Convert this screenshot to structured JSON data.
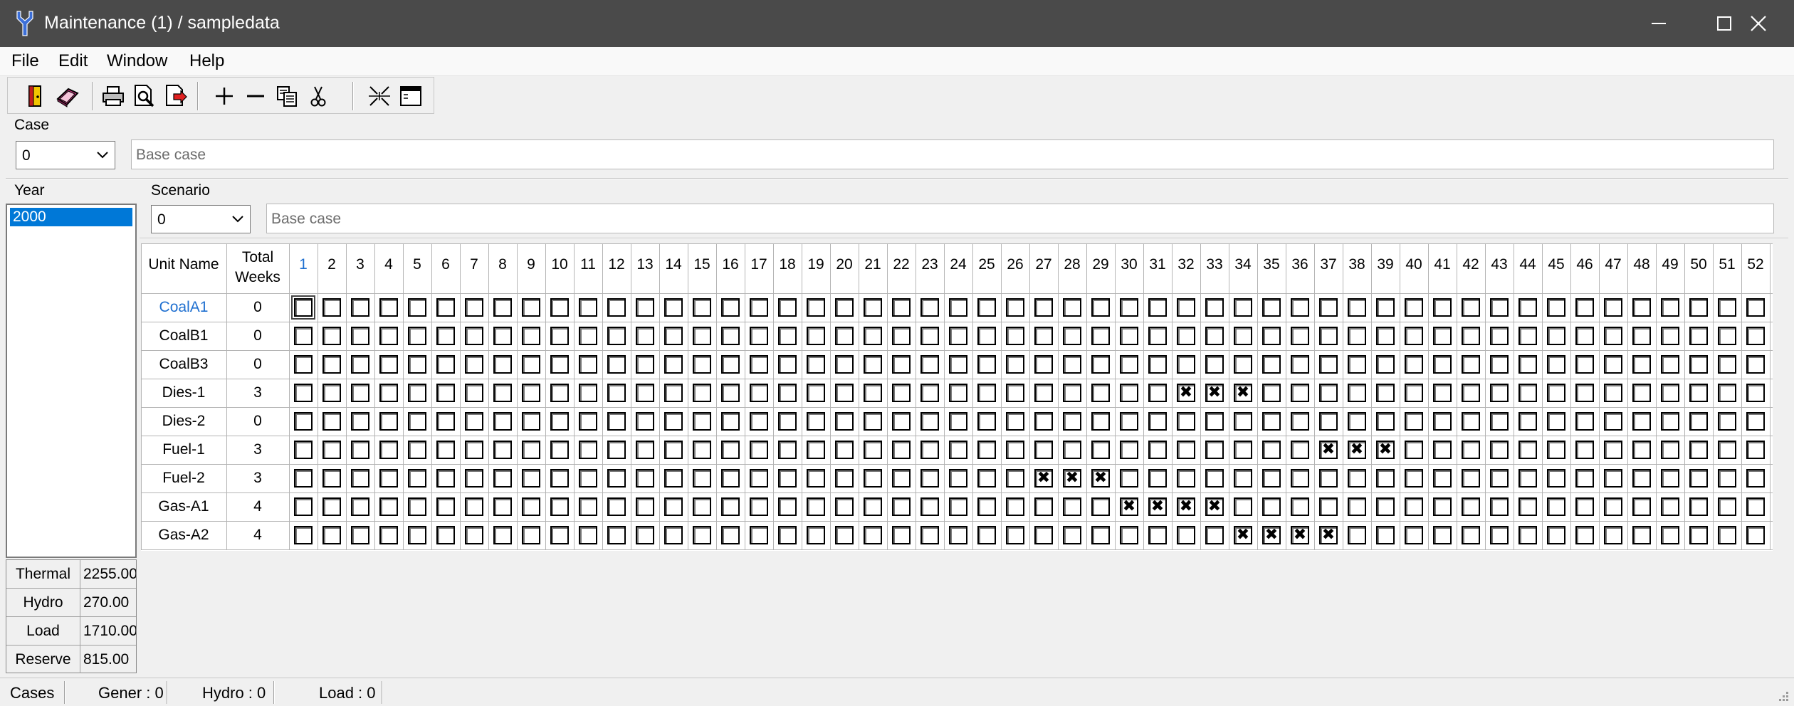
{
  "window": {
    "title": "Maintenance (1)  /  sampledata"
  },
  "menu": [
    "File",
    "Edit",
    "Window",
    "Help"
  ],
  "toolbar_icons": [
    "exit-icon",
    "book-icon",
    "print-icon",
    "print-preview-icon",
    "export-icon",
    "add-icon",
    "remove-icon",
    "copy-icon",
    "cut-icon",
    "expand-icon",
    "window-icon"
  ],
  "case": {
    "label": "Case",
    "value": "0",
    "description": "Base case"
  },
  "year": {
    "label": "Year",
    "items": [
      "2000"
    ],
    "selected": "2000"
  },
  "scenario": {
    "label": "Scenario",
    "value": "0",
    "description": "Base case"
  },
  "summary": [
    {
      "label": "Thermal",
      "value": "2255.00"
    },
    {
      "label": "Hydro",
      "value": "270.00"
    },
    {
      "label": "Load",
      "value": "1710.00"
    },
    {
      "label": "Reserve",
      "value": "815.00"
    }
  ],
  "grid": {
    "header_unit": "Unit Name",
    "header_total_1": "Total",
    "header_total_2": "Weeks",
    "weeks": 52,
    "active_week": 1,
    "rows": [
      {
        "name": "CoalA1",
        "total": "0",
        "checked": []
      },
      {
        "name": "CoalB1",
        "total": "0",
        "checked": []
      },
      {
        "name": "CoalB3",
        "total": "0",
        "checked": []
      },
      {
        "name": "Dies-1",
        "total": "3",
        "checked": [
          32,
          33,
          34
        ]
      },
      {
        "name": "Dies-2",
        "total": "0",
        "checked": []
      },
      {
        "name": "Fuel-1",
        "total": "3",
        "checked": [
          37,
          38,
          39
        ]
      },
      {
        "name": "Fuel-2",
        "total": "3",
        "checked": [
          27,
          28,
          29
        ]
      },
      {
        "name": "Gas-A1",
        "total": "4",
        "checked": [
          30,
          31,
          32,
          33
        ]
      },
      {
        "name": "Gas-A2",
        "total": "4",
        "checked": [
          34,
          35,
          36,
          37
        ]
      }
    ],
    "active_row": "CoalA1"
  },
  "status": {
    "cases": "Cases",
    "gener": "Gener : 0",
    "hydro": "Hydro : 0",
    "load": "Load : 0"
  },
  "colors": {
    "titlebar": "#4a4a4a",
    "selection": "#0078d7",
    "active_text": "#1e6fd0",
    "check_mark": "#000000"
  }
}
